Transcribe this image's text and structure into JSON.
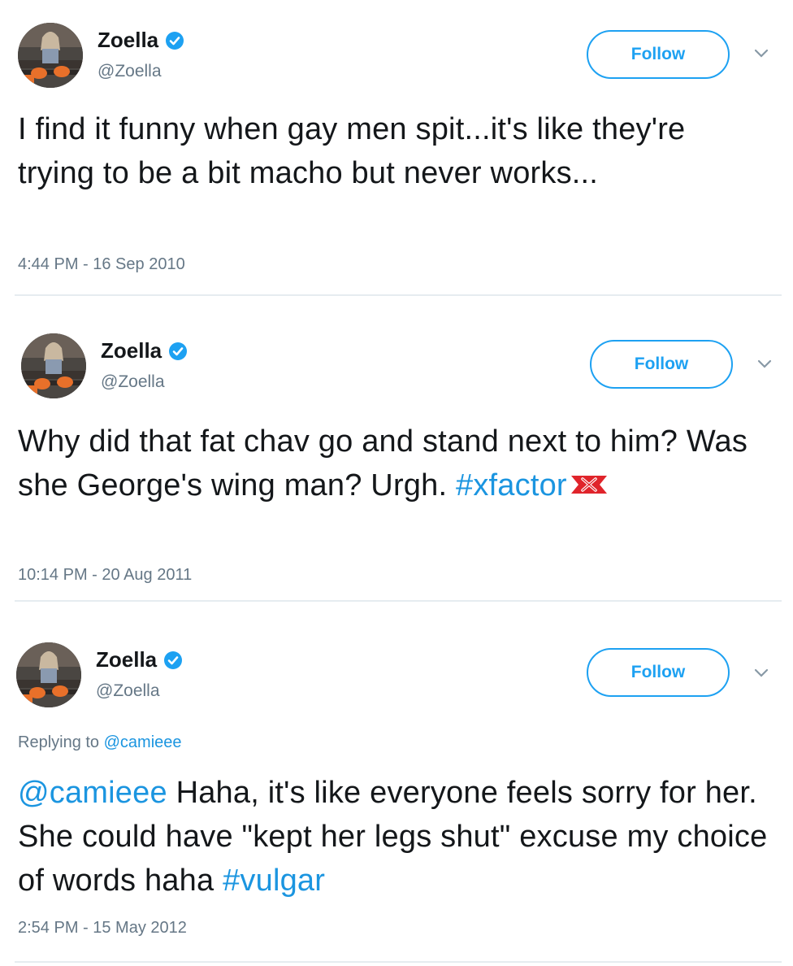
{
  "tweets": [
    {
      "name": "Zoella",
      "handle": "@Zoella",
      "follow_label": "Follow",
      "text": "I find it funny when gay men spit...it's like they're trying to be a bit macho but never works...",
      "timestamp": "4:44 PM - 16 Sep 2010"
    },
    {
      "name": "Zoella",
      "handle": "@Zoella",
      "follow_label": "Follow",
      "text": "Why did that fat chav go and stand next to him? Was she George's wing man? Urgh.",
      "hashtag": "#xfactor",
      "timestamp": "10:14 PM - 20 Aug 2011"
    },
    {
      "name": "Zoella",
      "handle": "@Zoella",
      "follow_label": "Follow",
      "replying_prefix": "Replying to",
      "replying_to": "@camieee",
      "mention": "@camieee",
      "text": " Haha, it's like everyone feels sorry for her. She could have \"kept her legs shut\" excuse my choice of words haha",
      "hashtag": "#vulgar",
      "timestamp": "2:54 PM - 15 May 2012"
    }
  ],
  "icons": {
    "verified": "verified-badge-icon",
    "chevron": "chevron-down-icon",
    "xfactor": "xfactor-hashflag-icon"
  },
  "colors": {
    "accent": "#1da1f2",
    "link": "#1b95e0",
    "muted": "#657786",
    "xfactor_red": "#e0242b"
  }
}
